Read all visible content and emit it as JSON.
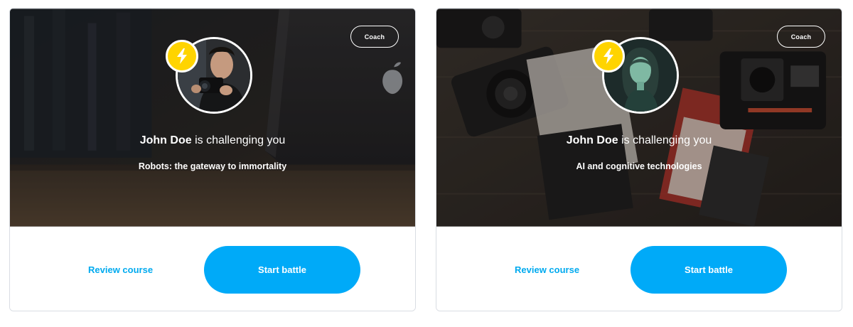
{
  "cards": [
    {
      "badge": "Coach",
      "challenger_name": "John Doe",
      "challenge_text": " is challenging you",
      "course_title": "Robots: the gateway to immortality",
      "review_label": "Review course",
      "start_label": "Start battle",
      "avatar_icon": "man-with-camera-avatar",
      "badge_icon": "lightning-bolt-icon"
    },
    {
      "badge": "Coach",
      "challenger_name": "John Doe",
      "challenge_text": " is challenging you",
      "course_title": "AI and cognitive technologies",
      "review_label": "Review course",
      "start_label": "Start battle",
      "avatar_icon": "woman-portrait-avatar",
      "badge_icon": "lightning-bolt-icon"
    }
  ],
  "colors": {
    "accent": "#00aaf8",
    "link": "#00aaef",
    "bolt": "#ffd400"
  }
}
